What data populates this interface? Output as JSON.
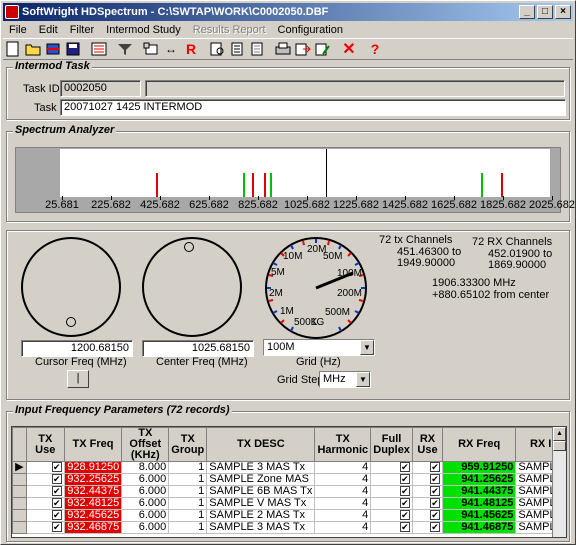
{
  "window": {
    "title": "SoftWright HDSpectrum - C:\\SWTAP\\WORK\\C0002050.DBF"
  },
  "menu": [
    "File",
    "Edit",
    "Filter",
    "Intermod Study",
    "Results Report",
    "Configuration"
  ],
  "intermod_task": {
    "title": "Intermod Task",
    "task_id_label": "Task ID:",
    "task_id": "0002050",
    "task_label": "Task",
    "task": "20071027 1425 INTERMOD"
  },
  "spectrum": {
    "title": "Spectrum Analyzer",
    "ticks": [
      "25.681",
      "225.682",
      "425.682",
      "625.682",
      "825.682",
      "1025.682",
      "1225.682",
      "1425.682",
      "1625.682",
      "1825.682",
      "2025.682"
    ]
  },
  "controls": {
    "cursor_freq": "1200.68150",
    "cursor_label": "Cursor Freq (MHz)",
    "center_freq": "1025.68150",
    "center_label": "Center Freq (MHz)",
    "grid_value": "100M",
    "grid_label": "Grid (Hz)",
    "grid_step_label": "Grid Step",
    "grid_step_value": "MHz",
    "dial_labels": [
      "10M",
      "20M",
      "50M",
      "100M",
      "200M",
      "500M",
      "1G",
      "500K",
      "1M",
      "2M",
      "5M"
    ],
    "tx_channels": "72 tx Channels",
    "tx_from": "451.46300 to",
    "tx_to": "1949.90000",
    "rx_channels": "72 RX Channels",
    "rx_from": "452.01900 to",
    "rx_to": "1869.90000",
    "cursor_readout": "1906.33300 MHz",
    "offset_readout": "+880.65102 from center",
    "bottom_btn": "|"
  },
  "input_params": {
    "title": "Input Frequency Parameters (72 records)",
    "columns": [
      "TX Use",
      "TX Freq",
      "TX Offset (KHz)",
      "TX Group",
      "TX DESC",
      "TX Harmonic",
      "Full Duplex",
      "RX Use",
      "RX Freq",
      "RX I"
    ],
    "rows": [
      {
        "tx_freq": "928.91250",
        "offset": "8.000",
        "group": "1",
        "desc": "SAMPLE 3 MAS Tx",
        "harm": "4",
        "rx_freq": "959.91250",
        "rxd": "SAMPLE"
      },
      {
        "tx_freq": "932.25625",
        "offset": "6.000",
        "group": "1",
        "desc": "SAMPLE Zone MAS",
        "harm": "4",
        "rx_freq": "941.25625",
        "rxd": "SAMPLE"
      },
      {
        "tx_freq": "932.44375",
        "offset": "6.000",
        "group": "1",
        "desc": "SAMPLE 6B MAS Tx",
        "harm": "4",
        "rx_freq": "941.44375",
        "rxd": "SAMPLE"
      },
      {
        "tx_freq": "932.48125",
        "offset": "6.000",
        "group": "1",
        "desc": "SAMPLE V MAS Tx",
        "harm": "4",
        "rx_freq": "941.48125",
        "rxd": "SAMPLE"
      },
      {
        "tx_freq": "932.45625",
        "offset": "6.000",
        "group": "1",
        "desc": "SAMPLE 2 MAS Tx",
        "harm": "4",
        "rx_freq": "941.45625",
        "rxd": "SAMPLE"
      },
      {
        "tx_freq": "932.46875",
        "offset": "6.000",
        "group": "1",
        "desc": "SAMPLE 3 MAS Tx",
        "harm": "4",
        "rx_freq": "941.46875",
        "rxd": "SAMPLE"
      }
    ]
  }
}
